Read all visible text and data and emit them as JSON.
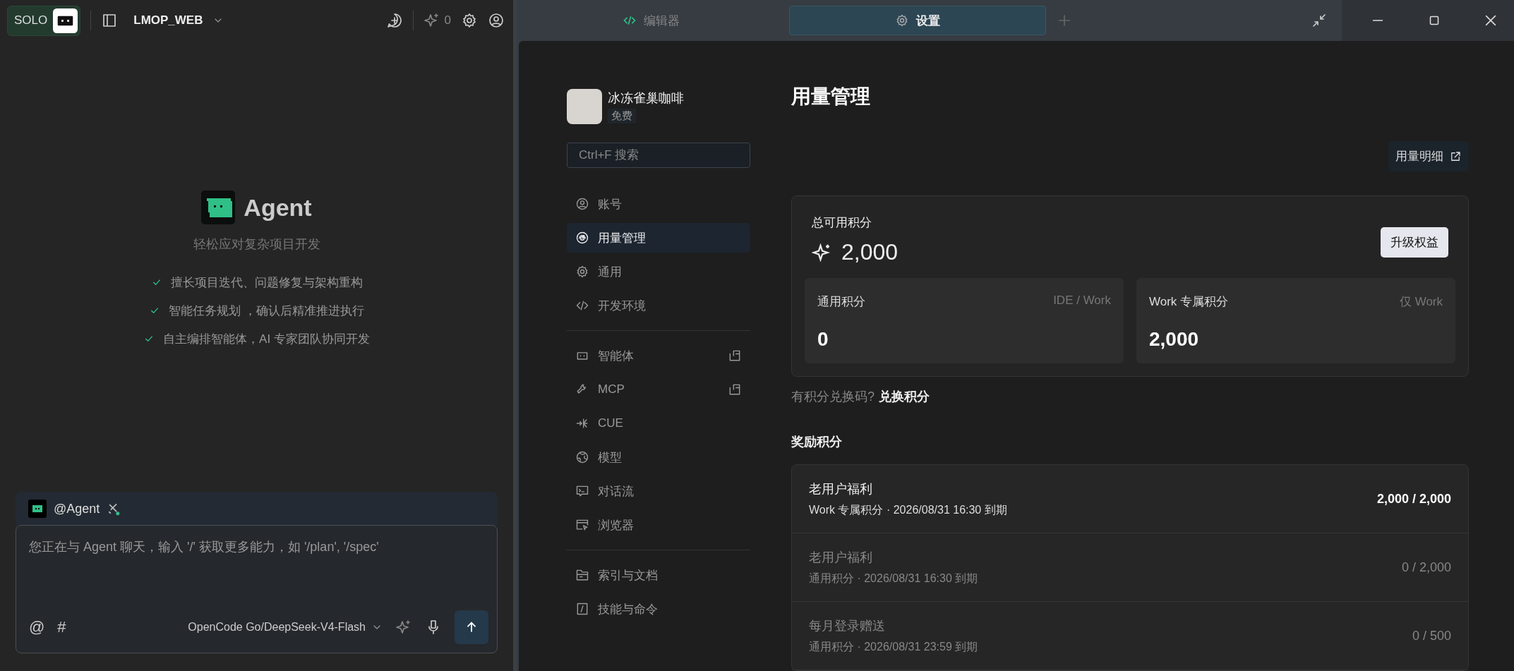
{
  "left_topbar": {
    "mode_badge": "SOLO",
    "project": "LMOP_WEB",
    "credits_count": "0"
  },
  "agent_intro": {
    "title": "Agent",
    "subtitle": "轻松应对复杂项目开发",
    "features": [
      "擅长项目迭代、问题修复与架构重构",
      "智能任务规划 ，确认后精准推进执行",
      "自主编排智能体，AI 专家团队协同开发"
    ]
  },
  "composer": {
    "agent_mention": "@Agent",
    "placeholder": "您正在与 Agent 聊天，输入 '/' 获取更多能力，如 '/plan', '/spec'",
    "at_symbol": "@",
    "hash_symbol": "#",
    "model": "OpenCode Go/DeepSeek-V4-Flash"
  },
  "tabs": [
    {
      "label": "编辑器",
      "selected": false
    },
    {
      "label": "设置",
      "selected": true
    }
  ],
  "settings_sidebar": {
    "user_name": "冰冻雀巢咖啡",
    "plan": "免费",
    "search_placeholder": "Ctrl+F 搜索",
    "groups": [
      [
        {
          "label": "账号",
          "selected": false,
          "external": false
        },
        {
          "label": "用量管理",
          "selected": true,
          "external": false
        },
        {
          "label": "通用",
          "selected": false,
          "external": false
        },
        {
          "label": "开发环境",
          "selected": false,
          "external": false
        }
      ],
      [
        {
          "label": "智能体",
          "selected": false,
          "external": true
        },
        {
          "label": "MCP",
          "selected": false,
          "external": true
        },
        {
          "label": "CUE",
          "selected": false,
          "external": false
        },
        {
          "label": "模型",
          "selected": false,
          "external": false
        },
        {
          "label": "对话流",
          "selected": false,
          "external": false
        },
        {
          "label": "浏览器",
          "selected": false,
          "external": false
        }
      ],
      [
        {
          "label": "索引与文档",
          "selected": false,
          "external": false
        },
        {
          "label": "技能与命令",
          "selected": false,
          "external": false
        }
      ]
    ]
  },
  "usage": {
    "title": "用量管理",
    "details_button": "用量明细",
    "total_label": "总可用积分",
    "total_value": "2,000",
    "upgrade_button": "升级权益",
    "balances": [
      {
        "label": "通用积分",
        "scope": "IDE / Work",
        "value": "0"
      },
      {
        "label": "Work 专属积分",
        "scope": "仅 Work",
        "value": "2,000"
      }
    ],
    "redeem_prompt": "有积分兑换码?",
    "redeem_link": "兑换积分",
    "rewards_title": "奖励积分",
    "rewards": [
      {
        "name": "老用户福利",
        "detail": "Work 专属积分 · 2026/08/31 16:30 到期",
        "amount": "2,000 / 2,000",
        "active": true
      },
      {
        "name": "老用户福利",
        "detail": "通用积分 · 2026/08/31 16:30 到期",
        "amount": "0 / 2,000",
        "active": false
      },
      {
        "name": "每月登录赠送",
        "detail": "通用积分 · 2026/08/31 23:59 到期",
        "amount": "0 / 500",
        "active": false
      }
    ]
  }
}
